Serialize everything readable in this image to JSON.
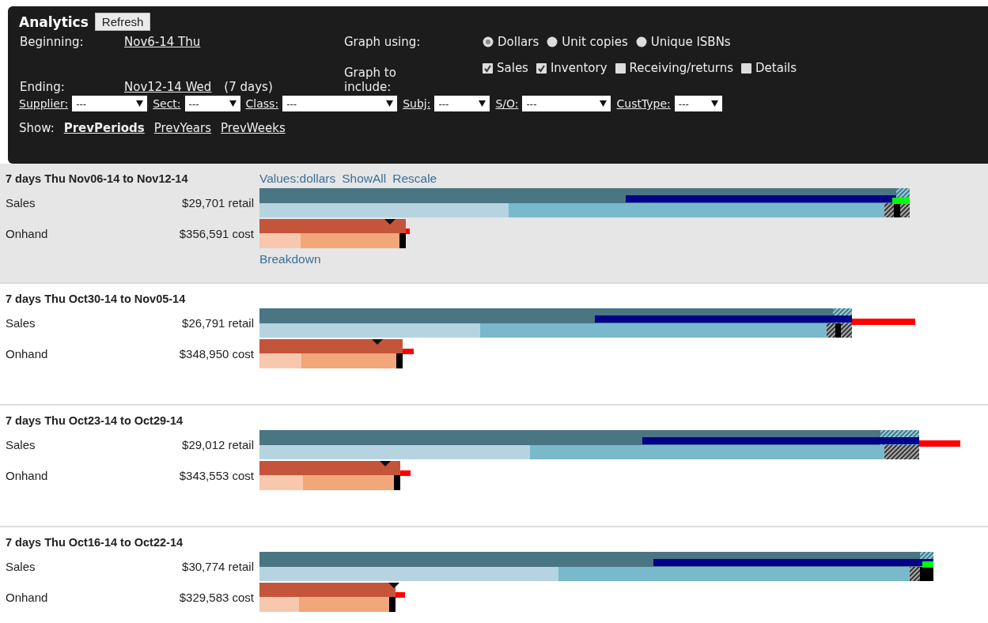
{
  "header": {
    "title": "Analytics",
    "refresh_button": "Refresh",
    "beginning": {
      "label": "Beginning:",
      "value": "Nov6-14 Thu"
    },
    "ending": {
      "label": "Ending:",
      "value": "Nov12-14 Wed",
      "duration": "(7 days)"
    },
    "graph_using": {
      "label": "Graph using:",
      "options": [
        {
          "label": "Dollars",
          "selected": true
        },
        {
          "label": "Unit copies",
          "selected": false
        },
        {
          "label": "Unique ISBNs",
          "selected": false
        }
      ]
    },
    "graph_include": {
      "label": "Graph to include:",
      "options": [
        {
          "label": "Sales",
          "checked": true
        },
        {
          "label": "Inventory",
          "checked": true
        },
        {
          "label": "Receiving/returns",
          "checked": false
        },
        {
          "label": "Details",
          "checked": false
        }
      ]
    },
    "filters": [
      {
        "label": "Supplier:",
        "value": "---"
      },
      {
        "label": "Sect:",
        "value": "---"
      },
      {
        "label": "Class:",
        "value": "---"
      },
      {
        "label": "Subj:",
        "value": "---"
      },
      {
        "label": "S/O:",
        "value": "---"
      },
      {
        "label": "CustType:",
        "value": "---"
      }
    ],
    "show": {
      "label": "Show:",
      "links": [
        {
          "label": "PrevPeriods",
          "selected": true
        },
        {
          "label": "PrevYears",
          "selected": false
        },
        {
          "label": "PrevWeeks",
          "selected": false
        }
      ]
    }
  },
  "periods": [
    {
      "title": "7 days Thu Nov06-14 to Nov12-14",
      "selected": true,
      "links": [
        "Values:dollars",
        "ShowAll",
        "Rescale"
      ],
      "rows": [
        {
          "name": "Sales",
          "value": "$29,701 retail"
        },
        {
          "name": "Onhand",
          "value": "$356,591 cost"
        }
      ],
      "footer_link": "Breakdown"
    },
    {
      "title": "7 days Thu Oct30-14 to Nov05-14",
      "selected": false,
      "rows": [
        {
          "name": "Sales",
          "value": "$26,791 retail"
        },
        {
          "name": "Onhand",
          "value": "$348,950 cost"
        }
      ]
    },
    {
      "title": "7 days Thu Oct23-14 to Oct29-14",
      "selected": false,
      "rows": [
        {
          "name": "Sales",
          "value": "$29,012 retail"
        },
        {
          "name": "Onhand",
          "value": "$343,553 cost"
        }
      ]
    },
    {
      "title": "7 days Thu Oct16-14 to Oct22-14",
      "selected": false,
      "rows": [
        {
          "name": "Sales",
          "value": "$30,774 retail"
        },
        {
          "name": "Onhand",
          "value": "$329,583 cost"
        }
      ]
    }
  ]
}
